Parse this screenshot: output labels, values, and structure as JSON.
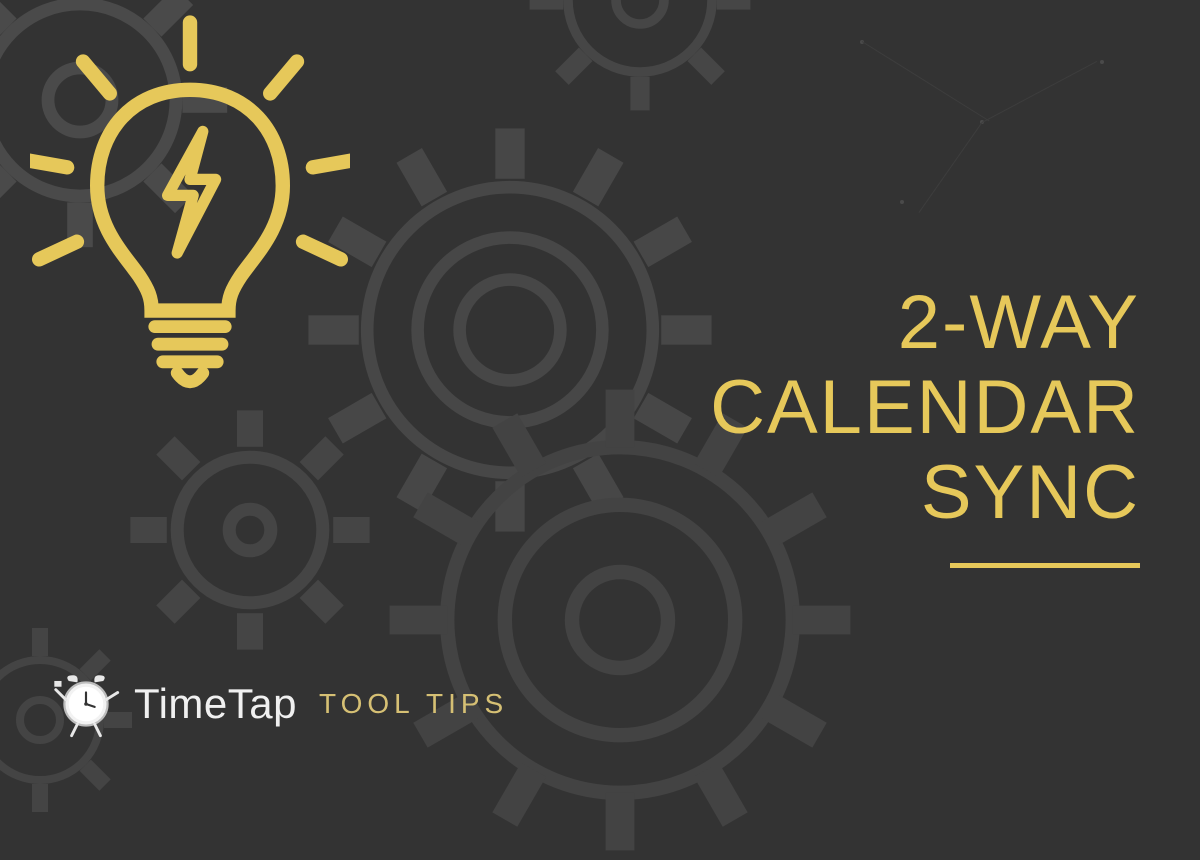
{
  "colors": {
    "background": "#333333",
    "accent": "#e6c85a",
    "gear": "#444444",
    "brandText": "#f0f0f0",
    "tagline": "#d6c074"
  },
  "title": {
    "line1": "2-WAY",
    "line2": "CALENDAR",
    "line3": "SYNC"
  },
  "brand": {
    "name": "TimeTap",
    "tagline": "TOOL TIPS"
  },
  "icons": {
    "lightbulb": "lightbulb-icon",
    "gear": "gear-icon",
    "clock": "clock-mascot-icon"
  }
}
